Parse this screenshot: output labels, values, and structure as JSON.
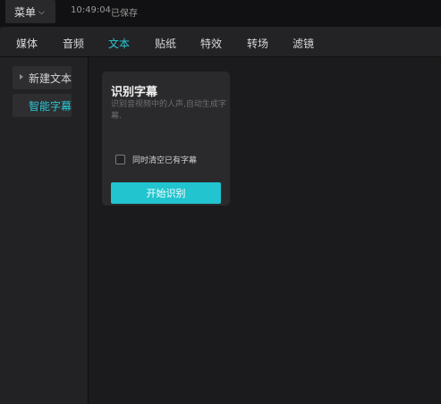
{
  "titlebar": {
    "menu_label": "菜单",
    "time": "10:49:04",
    "save_status": "已保存"
  },
  "tabs": [
    {
      "label": "媒体",
      "active": false
    },
    {
      "label": "音频",
      "active": false
    },
    {
      "label": "文本",
      "active": true
    },
    {
      "label": "贴纸",
      "active": false
    },
    {
      "label": "特效",
      "active": false
    },
    {
      "label": "转场",
      "active": false
    },
    {
      "label": "滤镜",
      "active": false
    }
  ],
  "sidebar": {
    "items": [
      {
        "label": "新建文本",
        "selected": false
      },
      {
        "label": "智能字幕",
        "selected": true
      }
    ]
  },
  "card": {
    "title": "识别字幕",
    "description": "识别音视频中的人声,自动生成字幕.",
    "checkbox_label": "同时清空已有字幕",
    "checkbox_checked": false,
    "button_label": "开始识别"
  },
  "colors": {
    "accent": "#28c9d5",
    "button": "#21c4cf",
    "background": "#1b1b1d"
  }
}
